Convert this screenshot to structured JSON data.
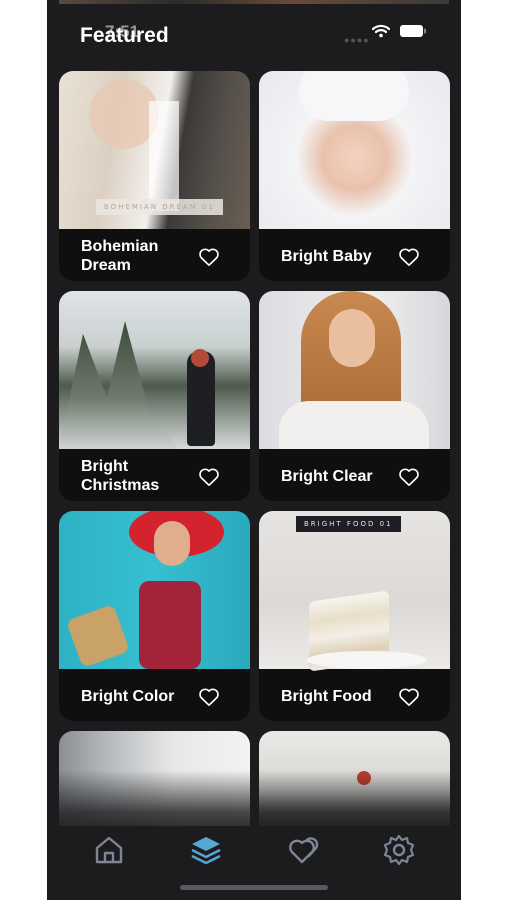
{
  "status_bar": {
    "time": "7:51"
  },
  "header": {
    "title": "Featured"
  },
  "cards": [
    {
      "label": "Bohemian Dream",
      "image_tag": "BOHEMIAN DREAM 01"
    },
    {
      "label": "Bright Baby"
    },
    {
      "label": "Bright Christmas"
    },
    {
      "label": "Bright Clear"
    },
    {
      "label": "Bright Color"
    },
    {
      "label": "Bright Food",
      "image_tag": "BRIGHT FOOD 01"
    }
  ],
  "tabbar": {
    "items": [
      "home-icon",
      "layers-icon",
      "favorites-icon",
      "settings-icon"
    ],
    "active_index": 1
  },
  "colors": {
    "background": "#1c1c1e",
    "card": "#0f0f10",
    "accent": "#57a7d6",
    "icon": "#7d8597"
  }
}
